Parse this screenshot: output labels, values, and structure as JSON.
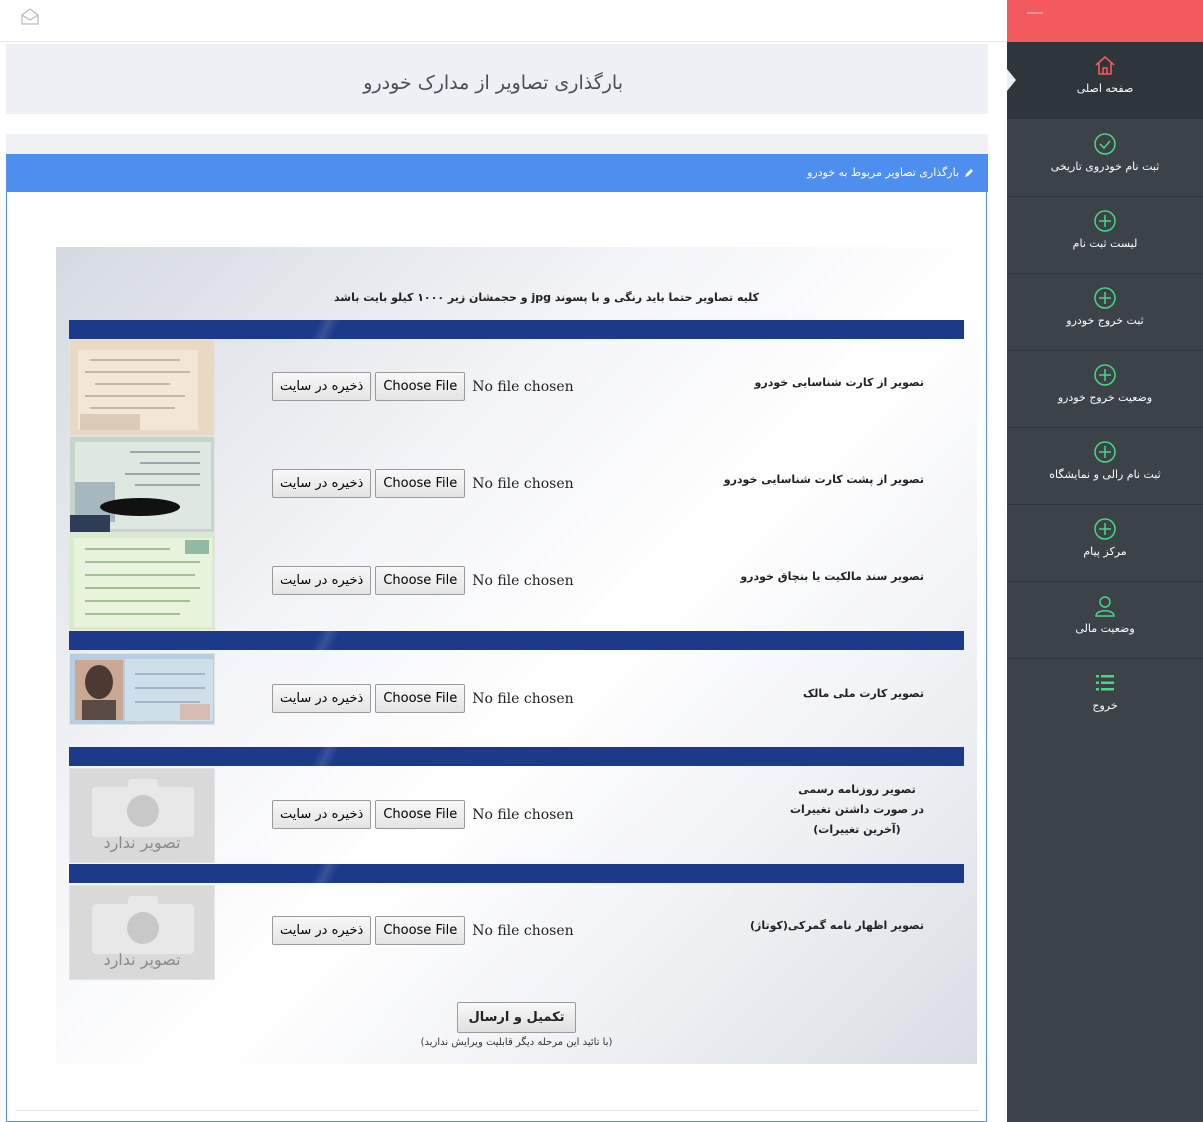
{
  "header": {
    "mail_icon": "envelope-open-icon"
  },
  "page": {
    "title": "بارگذاری تصاویر از مدارک خودرو"
  },
  "panel": {
    "heading": "بارگذاری تصاویر مربوط به خودرو",
    "heading_icon": "pencil-icon",
    "note": "کلیه تصاویر حتما باید رنگی و با پسوند jpg و حجمشان زیر ۱۰۰۰ کیلو بایت باشد",
    "file_button_label": "Choose File",
    "no_file_text": "No file chosen",
    "save_label": "ذخیره در سایت",
    "placeholder_text": "تصویر ندارد",
    "rows": [
      {
        "label": "تصویر از کارت شناسایی خودرو"
      },
      {
        "label": "تصویر از پشت کارت شناسایی خودرو"
      },
      {
        "label": "تصویر سند مالکیت یا بنچاق خودرو"
      },
      {
        "label": "تصویر کارت ملی مالک"
      },
      {
        "label_lines": [
          "تصویر روزنامه رسمی",
          "در صورت داشتن تغییرات",
          "(آخرین تغییرات)"
        ]
      },
      {
        "label": "تصویر اظهار نامه گمرکی(کوتاژ)"
      }
    ],
    "submit_label": "تکمیل و ارسال",
    "submit_note": "(با تائید این مرحله دیگر قابلیت ویرایش ندارید)"
  },
  "sidebar": {
    "accent_color": "#f25a5e",
    "background_color": "#3b4349",
    "items": [
      {
        "label": "صفحه اصلی",
        "icon": "home-icon"
      },
      {
        "label": "ثبت نام خودروی تاریخی",
        "icon": "check-circle-icon"
      },
      {
        "label": "لیست ثبت نام",
        "icon": "plus-circle-icon"
      },
      {
        "label": "ثبت خروج خودرو",
        "icon": "plus-circle-icon"
      },
      {
        "label": "وضعیت خروج خودرو",
        "icon": "plus-circle-icon"
      },
      {
        "label": "ثبت نام رالی و نمایشگاه",
        "icon": "plus-circle-icon"
      },
      {
        "label": "مرکز پیام",
        "icon": "plus-circle-icon"
      },
      {
        "label": "وضعیت مالی",
        "icon": "user-icon"
      },
      {
        "label": "خروج",
        "icon": "list-icon"
      }
    ]
  }
}
